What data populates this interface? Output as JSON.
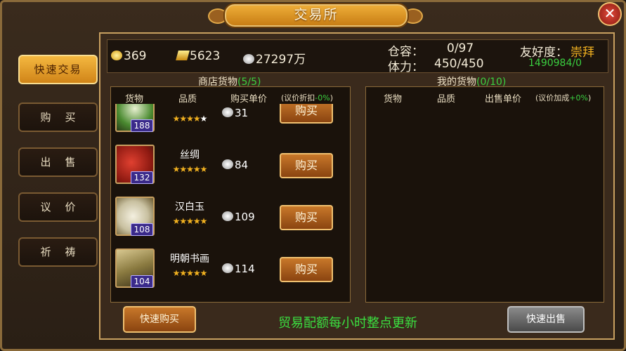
{
  "window": {
    "title": "交易所",
    "close_label": "✕"
  },
  "menu": [
    {
      "label": "快速交易",
      "active": true
    },
    {
      "label": "购买",
      "active": false
    },
    {
      "label": "出售",
      "active": false
    },
    {
      "label": "议价",
      "active": false
    },
    {
      "label": "祈祷",
      "active": false
    }
  ],
  "stats": {
    "gold": "369",
    "ingot": "5623",
    "silver": "27297万",
    "warehouse_label": "仓容：",
    "warehouse_value": "0/97",
    "stamina_label": "体力：",
    "stamina_value": "450/450",
    "friend_label": "友好度：",
    "friend_level": "崇拜",
    "friend_points": "1490984/0"
  },
  "shop": {
    "title": "商店货物",
    "count": "(5/5)",
    "col_goods": "货物",
    "col_quality": "品质",
    "col_price": "购买单价",
    "col_discount": "(议价折扣",
    "col_discount_pct": "-0%",
    "col_discount_end": ")",
    "items": [
      {
        "name": "",
        "level": "188",
        "stars": "★★★★",
        "star_empty": "★",
        "price": "31",
        "buy": "购买"
      },
      {
        "name": "丝绸",
        "level": "132",
        "stars": "★★★★★",
        "star_empty": "",
        "price": "84",
        "buy": "购买"
      },
      {
        "name": "汉白玉",
        "level": "108",
        "stars": "★★★★★",
        "star_empty": "",
        "price": "109",
        "buy": "购买"
      },
      {
        "name": "明朝书画",
        "level": "104",
        "stars": "★★★★★",
        "star_empty": "",
        "price": "114",
        "buy": "购买"
      }
    ]
  },
  "mine": {
    "title": "我的货物",
    "count": "(0/10)",
    "col_goods": "货物",
    "col_quality": "品质",
    "col_price": "出售单价",
    "col_bonus": "(议价加成",
    "col_bonus_pct": "+0%",
    "col_bonus_end": ")"
  },
  "footer": {
    "quick_buy": "快速购买",
    "notice": "贸易配额每小时整点更新",
    "quick_sell": "快速出售"
  },
  "colors": {
    "accent": "#f0b03a",
    "green": "#3ad040",
    "friend": "#f0b020"
  }
}
